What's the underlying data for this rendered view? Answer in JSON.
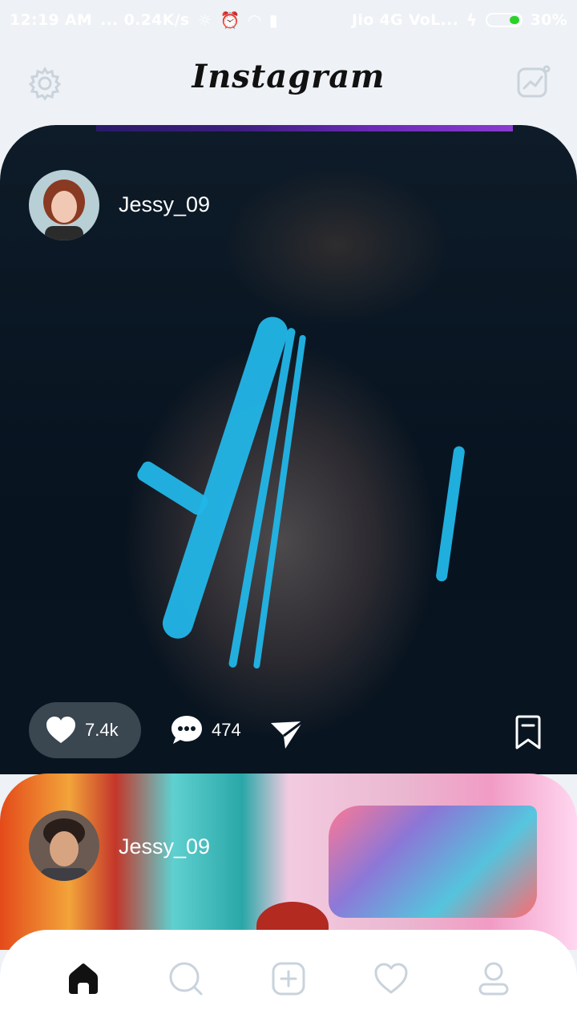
{
  "status_bar": {
    "time": "12:19 AM",
    "network_speed": "... 0.24K/s",
    "carrier": "Jio 4G VoL...",
    "battery": "30%"
  },
  "header": {
    "logo_text": "Instagram"
  },
  "posts": [
    {
      "username": "Jessy_09",
      "likes": "7.4k",
      "comments": "474"
    },
    {
      "username": "Jessy_09"
    }
  ],
  "bottom_nav": {
    "items": [
      "home-icon",
      "search-icon",
      "add-icon",
      "heart-icon",
      "profile-icon"
    ],
    "active": "home"
  },
  "colors": {
    "accent_paint": "#22b6e8",
    "background": "#eef1f5",
    "active_nav": "#111111",
    "inactive_nav": "#c9d3dc"
  }
}
